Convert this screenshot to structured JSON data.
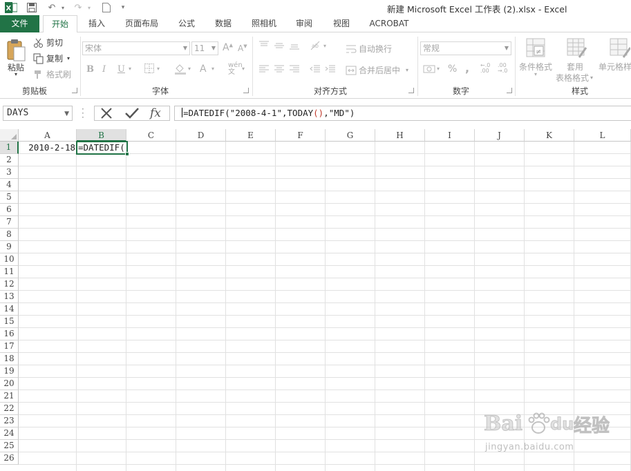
{
  "app": {
    "title": "新建 Microsoft Excel 工作表 (2).xlsx - Excel"
  },
  "tabs": [
    {
      "label": "文件",
      "state": "file"
    },
    {
      "label": "开始",
      "state": "active"
    },
    {
      "label": "插入"
    },
    {
      "label": "页面布局"
    },
    {
      "label": "公式"
    },
    {
      "label": "数据"
    },
    {
      "label": "照相机"
    },
    {
      "label": "审阅"
    },
    {
      "label": "视图"
    },
    {
      "label": "ACROBAT"
    }
  ],
  "ribbon": {
    "clipboard": {
      "paste": "粘贴",
      "cut": "剪切",
      "copy": "复制",
      "format_painter": "格式刷",
      "group": "剪贴板"
    },
    "font": {
      "font_name": "宋体",
      "font_size": "11",
      "bold": "B",
      "italic": "I",
      "underline": "U",
      "group": "字体"
    },
    "alignment": {
      "wrap_text": "自动换行",
      "merge_center": "合并后居中",
      "group": "对齐方式"
    },
    "number": {
      "format": "常规",
      "percent": "%",
      "comma": ",",
      "group": "数字"
    },
    "styles": {
      "conditional": "条件格式",
      "table_line1": "套用",
      "table_line2": "表格格式",
      "cell_styles": "单元格样",
      "group": "样式"
    }
  },
  "formula_bar": {
    "name_box": "DAYS",
    "fx": "fx",
    "formula_prefix": "=DATEDIF(\"2008-4-1\",TODAY",
    "formula_paren": "()",
    "formula_suffix": ",\"MD\")"
  },
  "grid": {
    "columns": [
      "A",
      "B",
      "C",
      "D",
      "E",
      "F",
      "G",
      "H",
      "I",
      "J",
      "K",
      "L"
    ],
    "selected_column": "B",
    "rows": [
      "1",
      "2",
      "3",
      "4",
      "5",
      "6",
      "7",
      "8",
      "9",
      "10",
      "11",
      "12",
      "13",
      "14",
      "15",
      "16",
      "17",
      "18",
      "19",
      "20",
      "21",
      "22",
      "23",
      "24",
      "25",
      "26"
    ],
    "selected_row": "1",
    "cells": {
      "A1": "2010-2-18",
      "B1": "=DATEDIF("
    }
  },
  "watermark": {
    "brand_latin": "Bai",
    "brand_du": "du",
    "brand_cn": "经验",
    "url": "jingyan.baidu.com"
  },
  "colors": {
    "accent": "#217346",
    "gridline": "#e1e1e1",
    "header_selected": "#e1e1e1"
  }
}
